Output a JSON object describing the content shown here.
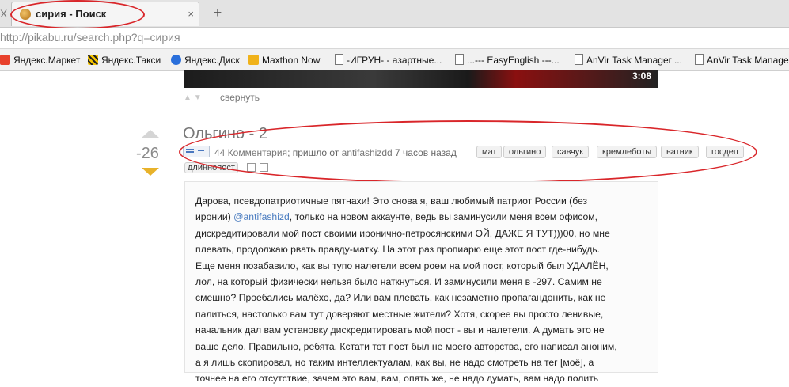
{
  "tab": {
    "prev_label": "X",
    "title": "сирия - Поиск",
    "close_label": "×",
    "new_tab_label": "+"
  },
  "address": {
    "url": "http://pikabu.ru/search.php?q=сирия"
  },
  "bookmarks": [
    {
      "label": "Яндекс.Маркет",
      "icon": "yandex-market-icon"
    },
    {
      "label": "Яндекс.Такси",
      "icon": "yandex-taxi-icon"
    },
    {
      "label": "Яндекс.Диск",
      "icon": "yandex-disk-icon"
    },
    {
      "label": "Maxthon Now",
      "icon": "maxthon-icon"
    },
    {
      "label": "-ИГРУН- - азартные...",
      "icon": "page-icon"
    },
    {
      "label": "...--- EasyEnglish ---...",
      "icon": "page-icon"
    },
    {
      "label": "AnVir Task Manager ...",
      "icon": "page-icon"
    },
    {
      "label": "AnVir Task Manager",
      "icon": "page-icon"
    }
  ],
  "video": {
    "time": "3:08"
  },
  "collapse_label": "свернуть",
  "post": {
    "score": "-26",
    "title": "Ольгино - 2",
    "comments_link": "44 Комментария",
    "from_text": "; пришло от",
    "author": "antifashizdd",
    "time_text": "7 часов назад",
    "tags": [
      "мат",
      "ольгино",
      "савчук",
      "кремлеботы",
      "ватник",
      "госдеп"
    ],
    "tag_last": "длиннопост",
    "body": {
      "l1": "Дарова, псевдопатриотичные пятнахи! Это снова я, ваш любимый патриот России (без",
      "l2_a": "иронии) ",
      "l2_link": "@antifashizd",
      "l2_b": ", только на новом аккаунте, ведь вы заминусили меня всем офисом,",
      "l3": "дискредитировали мой пост своими иронично-петросянскими ОЙ, ДАЖЕ Я ТУТ)))00, но мне",
      "l4": "плевать, продолжаю рвать правду-матку. На этот раз пропиарю еще этот пост где-нибудь.",
      "l5": "Еще меня позабавило, как вы тупо налетели всем роем на мой пост, который был УДАЛЁН,",
      "l6": "лол, на который физически нельзя было наткнуться. И заминусили меня в -297. Самим не",
      "l7": "смешно? Проебались малёхо, да? Или вам плевать, как незаметно пропагандонить, как не",
      "l8": "палиться, настолько вам тут доверяют местные жители? Хотя, скорее вы просто ленивые,",
      "l9": "начальник дал вам установку дискредитировать мой пост - вы и налетели. А думать это не",
      "l10": "ваше дело. Правильно, ребята. Кстати тот пост был не моего авторства, его написал аноним,",
      "l11": "а я лишь скопировал, но таким интеллектуалам, как вы, не надо смотреть на тег [моё], а",
      "l12": "точнее на его отсутствие, зачем это вам, вам, опять же, не надо думать, вам надо полить"
    }
  }
}
